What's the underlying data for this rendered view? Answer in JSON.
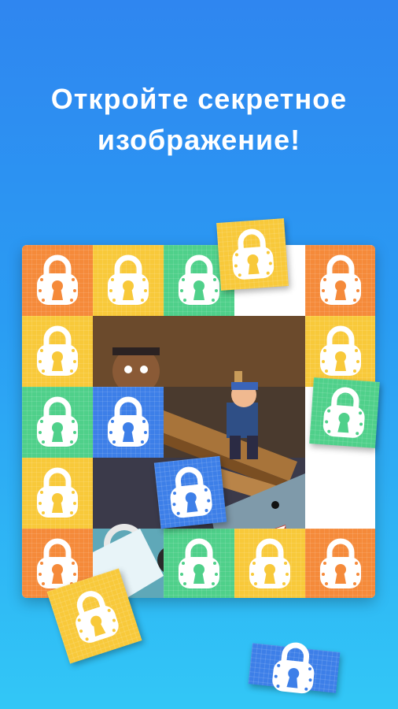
{
  "headline": {
    "line1": "Откройте секретное",
    "line2": "изображение!"
  },
  "colors": {
    "orange": "#f58a3a",
    "yellow": "#f8c93a",
    "green": "#4fd08a",
    "blue": "#3d7fe8",
    "lock_fill": "#ffffff",
    "bg_top": "#2f86f0",
    "bg_bottom": "#32c7f6"
  },
  "tiles": [
    {
      "row": 0,
      "col": 0,
      "color": "orange",
      "icon": "lock-icon"
    },
    {
      "row": 0,
      "col": 1,
      "color": "yellow",
      "icon": "lock-icon"
    },
    {
      "row": 0,
      "col": 2,
      "color": "green",
      "icon": "lock-icon"
    },
    {
      "row": 0,
      "col": 4,
      "color": "orange",
      "icon": "lock-icon"
    },
    {
      "row": 1,
      "col": 0,
      "color": "yellow",
      "icon": "lock-icon"
    },
    {
      "row": 1,
      "col": 4,
      "color": "yellow",
      "icon": "lock-icon"
    },
    {
      "row": 2,
      "col": 0,
      "color": "green",
      "icon": "lock-icon"
    },
    {
      "row": 2,
      "col": 1,
      "color": "blue",
      "icon": "lock-icon"
    },
    {
      "row": 3,
      "col": 0,
      "color": "yellow",
      "icon": "lock-icon"
    },
    {
      "row": 4,
      "col": 0,
      "color": "orange",
      "icon": "lock-icon"
    },
    {
      "row": 4,
      "col": 2,
      "color": "green",
      "icon": "lock-icon"
    },
    {
      "row": 4,
      "col": 3,
      "color": "yellow",
      "icon": "lock-icon"
    },
    {
      "row": 4,
      "col": 4,
      "color": "orange",
      "icon": "lock-icon"
    }
  ],
  "flying_tiles": [
    {
      "color": "yellow",
      "icon": "lock-icon"
    },
    {
      "color": "green",
      "icon": "lock-icon"
    },
    {
      "color": "blue",
      "icon": "lock-icon"
    },
    {
      "color": "yellow",
      "icon": "lock-icon"
    },
    {
      "color": "blue",
      "icon": "lock-icon"
    }
  ],
  "revealed_image": {
    "icon": "pirate-shark-scene"
  }
}
